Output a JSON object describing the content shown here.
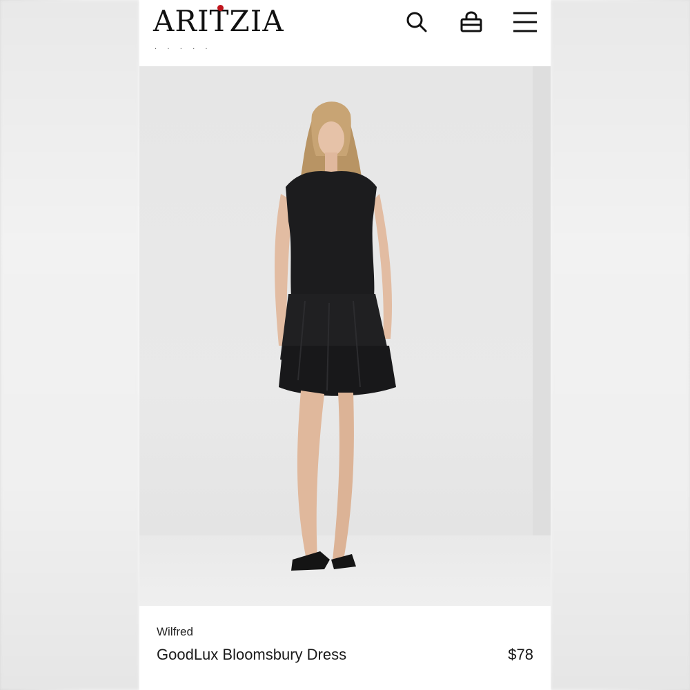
{
  "header": {
    "logo_text": "ARITZIA",
    "logo_accent_color": "#c0141c",
    "icons": [
      "search-icon",
      "shopping-bag-icon",
      "hamburger-menu-icon"
    ]
  },
  "hero": {
    "description_colors": {
      "background": "#e8e8e8",
      "dress": "#1c1c1e"
    }
  },
  "product": {
    "brand": "Wilfred",
    "name": "GoodLux Bloomsbury Dress",
    "price": "$78"
  }
}
